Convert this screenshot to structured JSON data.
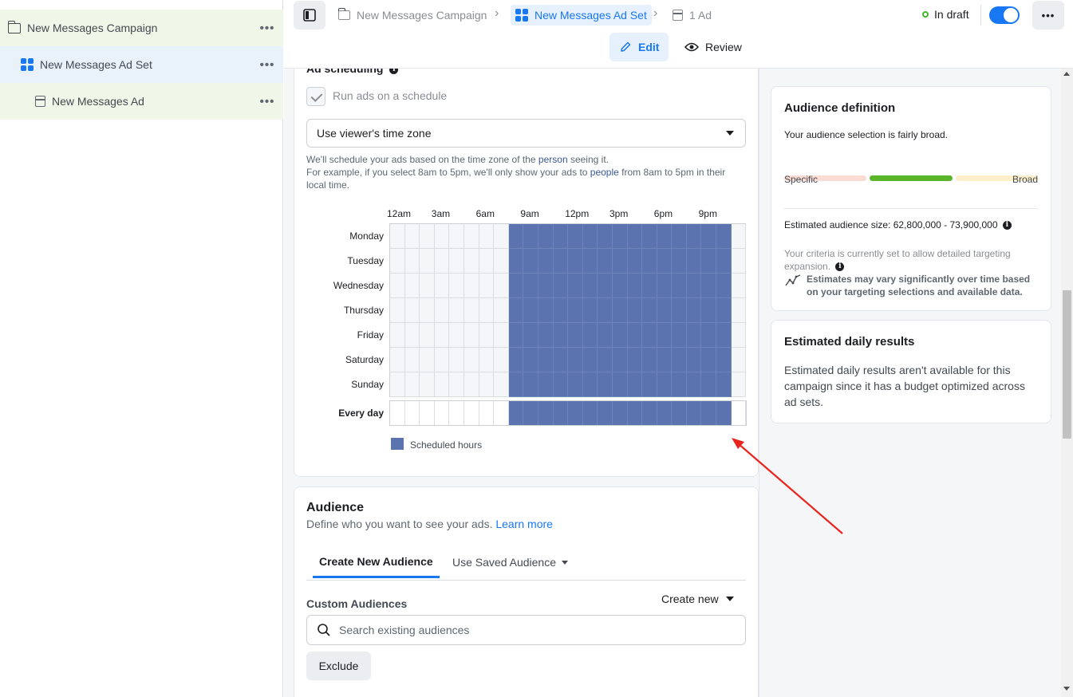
{
  "tree": {
    "items": [
      {
        "label": "New Messages Campaign",
        "more": "•••"
      },
      {
        "label": "New Messages Ad Set",
        "more": "•••"
      },
      {
        "label": "New Messages Ad",
        "more": "•••"
      }
    ]
  },
  "breadcrumb": {
    "campaign": "New Messages Campaign",
    "ad_set": "New Messages Ad Set",
    "ads": "1 Ad"
  },
  "status": {
    "label": "In draft",
    "color": "#42b72a"
  },
  "header": {
    "more": "•••",
    "edit_label": "Edit",
    "review_label": "Review"
  },
  "scheduling": {
    "title": "Ad scheduling",
    "run_on_schedule_label": "Run ads on a schedule",
    "run_on_schedule_checked": true,
    "time_zone_value": "Use viewer's time zone",
    "help_line1_a": "We'll schedule your ads based on the time zone of the ",
    "help_line1_link": "person",
    "help_line1_b": " seeing it.",
    "help_line2_a": "For example, if you select 8am to 5pm, we'll only show your ads to ",
    "help_line2_link": "people",
    "help_line2_b": " from 8am to 5pm in their local time.",
    "hour_labels": [
      "12am",
      "3am",
      "6am",
      "9am",
      "12pm",
      "3pm",
      "6pm",
      "9pm"
    ],
    "days": [
      "Monday",
      "Tuesday",
      "Wednesday",
      "Thursday",
      "Friday",
      "Saturday",
      "Sunday"
    ],
    "every_day_label": "Every day",
    "scheduled_start_hour": 8,
    "scheduled_end_hour": 23,
    "legend_label": "Scheduled hours",
    "scheduled_color": "#5b74b0"
  },
  "audience": {
    "title": "Audience",
    "subtitle": "Define who you want to see your ads.",
    "learn_more": "Learn more",
    "tab_create": "Create New Audience",
    "tab_saved": "Use Saved Audience",
    "custom_audiences_label": "Custom Audiences",
    "create_new_label": "Create new",
    "search_placeholder": "Search existing audiences",
    "exclude_label": "Exclude"
  },
  "audience_definition": {
    "title": "Audience definition",
    "summary": "Your audience selection is fairly broad.",
    "specific_label": "Specific",
    "broad_label": "Broad",
    "size_text": "Estimated audience size: 62,800,000 - 73,900,000",
    "criteria_text": "Your criteria is currently set to allow detailed targeting expansion.",
    "estimates_note": "Estimates may vary significantly over time based on your targeting selections and available data."
  },
  "daily_results": {
    "title": "Estimated daily results",
    "body": "Estimated daily results aren't available for this campaign since it has a budget optimized across ad sets."
  },
  "colors": {
    "accent": "#1877f2",
    "annotation_arrow": "#e8251f"
  }
}
